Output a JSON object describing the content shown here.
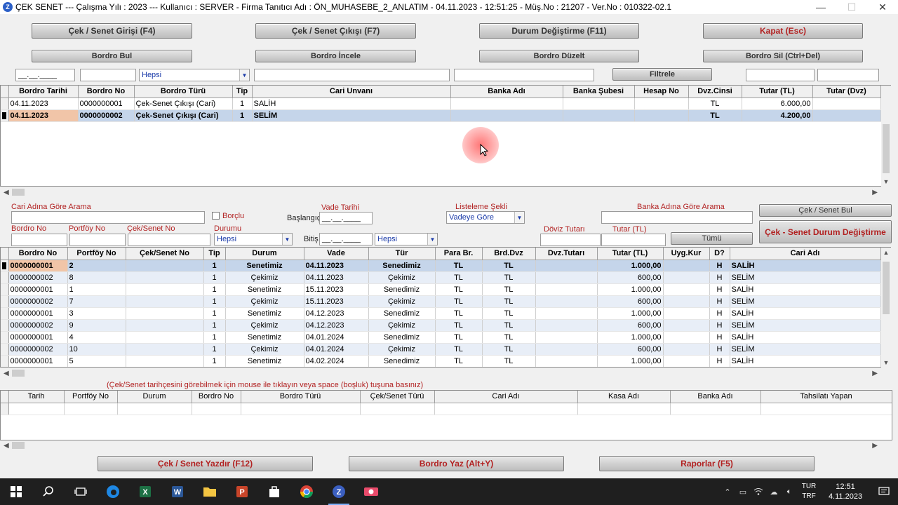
{
  "window": {
    "icon_letter": "Z",
    "title": "ÇEK SENET  ---  Çalışma Yılı : 2023  ---  Kullanıcı : SERVER - Firma Tanıtıcı Adı : ÖN_MUHASEBE_2_ANLATIM - 04.11.2023 - 12:51:25 - Müş.No : 21207 - Ver.No : 010322-02.1",
    "minimize": "—",
    "maximize": "☐",
    "close": "✕"
  },
  "toolbar": {
    "row1": [
      "Çek / Senet Girişi (F4)",
      "Çek / Senet Çıkışı (F7)",
      "Durum Değiştirme (F11)",
      "Kapat (Esc)"
    ],
    "row2": [
      "Bordro Bul",
      "Bordro İncele",
      "Bordro Düzelt",
      "Bordro Sil (Ctrl+Del)"
    ]
  },
  "filter": {
    "date": "__.__.____",
    "type_value": "Hepsi",
    "button": "Filtrele"
  },
  "bordro": {
    "columns": [
      "Bordro Tarihi",
      "Bordro No",
      "Bordro Türü",
      "Tip",
      "Cari Unvanı",
      "Banka Adı",
      "Banka Şubesi",
      "Hesap No",
      "Dvz.Cinsi",
      "Tutar (TL)",
      "Tutar (Dvz)"
    ],
    "rows": [
      [
        "04.11.2023",
        "0000000001",
        "Çek-Senet Çıkışı (Cari)",
        "1",
        "SALİH",
        "",
        "",
        "",
        "TL",
        "6.000,00",
        ""
      ],
      [
        "04.11.2023",
        "0000000002",
        "Çek-Senet Çıkışı (Cari)",
        "1",
        "SELİM",
        "",
        "",
        "",
        "TL",
        "4.200,00",
        ""
      ]
    ]
  },
  "search": {
    "cari_label": "Cari Adına Göre Arama",
    "borclu": "Borçlu",
    "vade_label": "Vade Tarihi",
    "baslangic": "Başlangıç",
    "bitis": "Bitiş",
    "date": "__.__.____",
    "listeleme_label": "Listeleme Şekli",
    "listeleme_value": "Vadeye Göre",
    "banka_label": "Banka Adına Göre Arama",
    "bul_button": "Çek / Senet Bul",
    "durum_button": "Çek - Senet Durum Değiştirme",
    "bordro_no": "Bordro No",
    "portfoy_no": "Portföy No",
    "cek_no": "Çek/Senet No",
    "durumu": "Durumu",
    "durumu_value": "Hepsi",
    "tur_value": "Hepsi",
    "doviz": "Döviz Tutarı",
    "tutar": "Tutar (TL)",
    "tumu": "Tümü"
  },
  "cek": {
    "columns": [
      "Bordro No",
      "Portföy No",
      "Çek/Senet No",
      "Tip",
      "Durum",
      "Vade",
      "Tür",
      "Para Br.",
      "Brd.Dvz",
      "Dvz.Tutarı",
      "Tutar (TL)",
      "Uyg.Kur",
      "D?",
      "Cari Adı"
    ],
    "rows": [
      [
        "0000000001",
        "2",
        "",
        "1",
        "Senetimiz",
        "04.11.2023",
        "Senedimiz",
        "TL",
        "TL",
        "",
        "1.000,00",
        "",
        "H",
        "SALİH"
      ],
      [
        "0000000002",
        "8",
        "",
        "1",
        "Çekimiz",
        "04.11.2023",
        "Çekimiz",
        "TL",
        "TL",
        "",
        "600,00",
        "",
        "H",
        "SELİM"
      ],
      [
        "0000000001",
        "1",
        "",
        "1",
        "Senetimiz",
        "15.11.2023",
        "Senedimiz",
        "TL",
        "TL",
        "",
        "1.000,00",
        "",
        "H",
        "SALİH"
      ],
      [
        "0000000002",
        "7",
        "",
        "1",
        "Çekimiz",
        "15.11.2023",
        "Çekimiz",
        "TL",
        "TL",
        "",
        "600,00",
        "",
        "H",
        "SELİM"
      ],
      [
        "0000000001",
        "3",
        "",
        "1",
        "Senetimiz",
        "04.12.2023",
        "Senedimiz",
        "TL",
        "TL",
        "",
        "1.000,00",
        "",
        "H",
        "SALİH"
      ],
      [
        "0000000002",
        "9",
        "",
        "1",
        "Çekimiz",
        "04.12.2023",
        "Çekimiz",
        "TL",
        "TL",
        "",
        "600,00",
        "",
        "H",
        "SELİM"
      ],
      [
        "0000000001",
        "4",
        "",
        "1",
        "Senetimiz",
        "04.01.2024",
        "Senedimiz",
        "TL",
        "TL",
        "",
        "1.000,00",
        "",
        "H",
        "SALİH"
      ],
      [
        "0000000002",
        "10",
        "",
        "1",
        "Çekimiz",
        "04.01.2024",
        "Çekimiz",
        "TL",
        "TL",
        "",
        "600,00",
        "",
        "H",
        "SELİM"
      ],
      [
        "0000000001",
        "5",
        "",
        "1",
        "Senetimiz",
        "04.02.2024",
        "Senedimiz",
        "TL",
        "TL",
        "",
        "1.000,00",
        "",
        "H",
        "SALİH"
      ]
    ]
  },
  "history": {
    "hint": "(Çek/Senet tarihçesini görebilmek için mouse ile tıklayın veya space (boşluk) tuşuna basınız)",
    "columns": [
      "Tarih",
      "Portföy No",
      "Durum",
      "Bordro No",
      "Bordro Türü",
      "Çek/Senet Türü",
      "Cari Adı",
      "Kasa Adı",
      "Banka Adı",
      "Tahsilatı Yapan"
    ]
  },
  "bottom": [
    "Çek / Senet Yazdır (F12)",
    "Bordro Yaz (Alt+Y)",
    "Raporlar (F5)"
  ],
  "taskbar": {
    "lang1": "TUR",
    "lang2": "TRF",
    "time": "12:51",
    "date": "4.11.2023"
  },
  "colors": {
    "accent_red": "#b22222",
    "selection": "#c5d5ea",
    "alt_row": "#e8eef7"
  }
}
